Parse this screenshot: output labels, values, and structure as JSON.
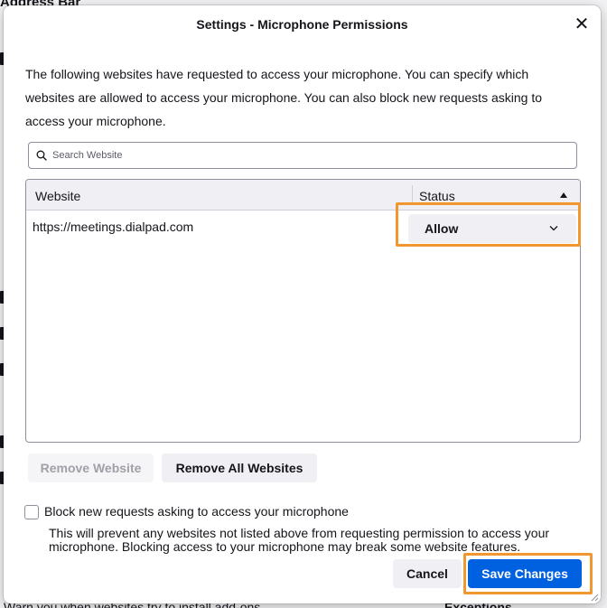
{
  "background": {
    "top_text": "Address Bar",
    "bottom_text": "Warn you when websites try to install add-ons",
    "exceptions_label": "Exceptions..."
  },
  "dialog": {
    "title": "Settings - Microphone Permissions",
    "close_glyph": "✕",
    "description": "The following websites have requested to access your microphone. You can specify which websites are allowed to access your microphone. You can also block new requests asking to access your microphone.",
    "search": {
      "placeholder": "Search Website",
      "icon": "search-icon"
    },
    "table": {
      "columns": [
        "Website",
        "Status"
      ],
      "sort_icon": "triangle-up-icon",
      "rows": [
        {
          "website": "https://meetings.dialpad.com",
          "status": "Allow"
        }
      ]
    },
    "buttons": {
      "remove_website": "Remove Website",
      "remove_all_websites": "Remove All Websites",
      "cancel": "Cancel",
      "save_changes": "Save Changes"
    },
    "block_checkbox": {
      "label": "Block new requests asking to access your microphone",
      "checked": false,
      "help": "This will prevent any websites not listed above from requesting permission to access your microphone. Blocking access to your microphone may break some website features."
    }
  },
  "colors": {
    "highlight": "#f0972f",
    "primary_button": "#0061e0",
    "text": "#15141a",
    "secondary_button": "#f0f0f4"
  }
}
